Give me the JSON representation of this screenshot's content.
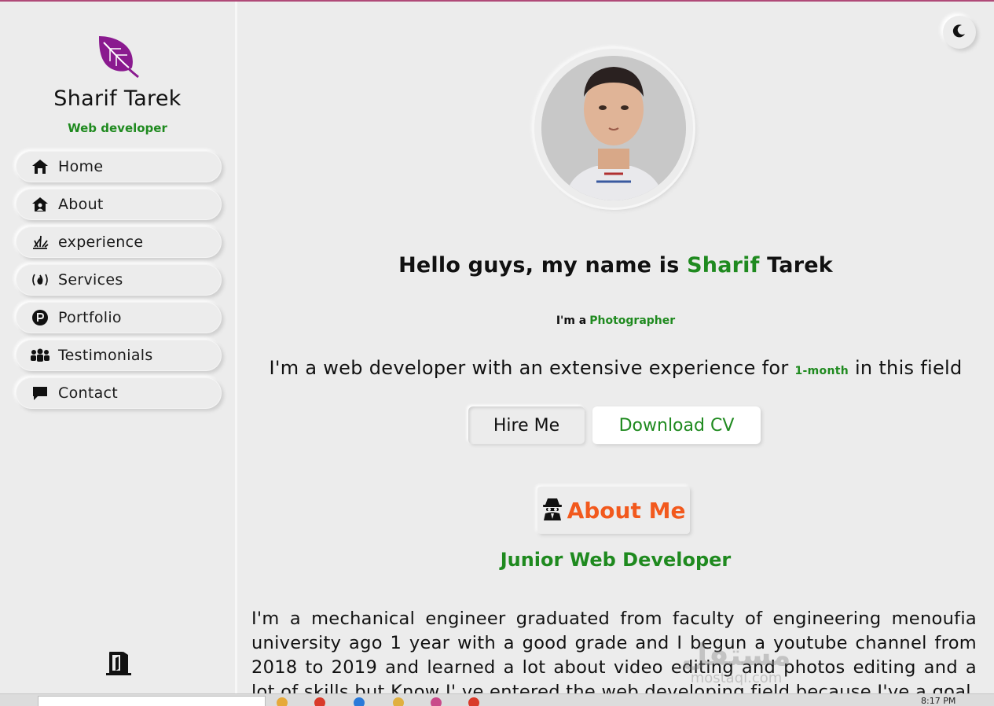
{
  "sidebar": {
    "logo_icon": "leaf-icon",
    "name": "Sharif Tarek",
    "role": "Web developer",
    "items": [
      {
        "label": "Home",
        "icon": "home-icon"
      },
      {
        "label": "About",
        "icon": "home-user-icon"
      },
      {
        "label": "experience",
        "icon": "burst-icon"
      },
      {
        "label": "Services",
        "icon": "fire-bracket-icon"
      },
      {
        "label": "Portfolio",
        "icon": "p-circle-icon"
      },
      {
        "label": "Testimonials",
        "icon": "people-icon"
      },
      {
        "label": "Contact",
        "icon": "chat-icon"
      }
    ],
    "logout_icon": "door-exit-icon"
  },
  "main": {
    "mode_icon": "moon-icon",
    "hello_prefix": "Hello guys, my name is",
    "first_name": "Sharif",
    "last_name": "Tarek",
    "im_a": "I'm a",
    "typed_role": "Photographer",
    "intro_prefix": "I'm a web developer with an extensive experience for",
    "duration": "1-month",
    "intro_suffix": "in this field",
    "hire_label": "Hire Me",
    "cv_label": "Download CV",
    "about_title": "About Me",
    "about_icon": "spy-icon",
    "subtitle": "Junior Web Developer",
    "paragraph": "I'm a mechanical engineer graduated from faculty of engineering menoufia university ago 1 year with a good grade and I begun a youtube channel from 2018 to 2019 and learned a lot about video editing and photos editing and a lot of skills but Know I' ve entered the web developing field because I've a goal",
    "watermark": "مستقل",
    "watermark_small": "mostaql.com"
  },
  "taskbar": {
    "time": "8:17 PM"
  },
  "colors": {
    "accent_green": "#1f8a1f",
    "accent_orange": "#f2591d",
    "logo_purple": "#8a1a8f",
    "background": "#ececec"
  }
}
